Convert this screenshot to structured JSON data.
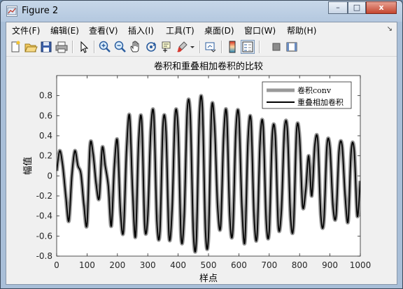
{
  "window": {
    "title": "Figure 2",
    "controls": {
      "minimize": "–",
      "maximize": "□",
      "close": "x"
    }
  },
  "menu": [
    "文件(F)",
    "编辑(E)",
    "查看(V)",
    "插入(I)",
    "工具(T)",
    "桌面(D)",
    "窗口(W)",
    "帮助(H)"
  ],
  "menu_overflow": "↘",
  "toolbar": [
    "new-figure-icon",
    "open-file-icon",
    "save-icon",
    "print-icon",
    "edit-plot-arrow-icon",
    "zoom-in-icon",
    "zoom-out-icon",
    "pan-hand-icon",
    "rotate-3d-icon",
    "data-cursor-icon",
    "brush-icon",
    "dropdown-arrow-icon",
    "link-plot-icon",
    "colorbar-icon",
    "legend-icon",
    "hide-plot-tools-icon",
    "show-plot-tools-icon"
  ],
  "colors": {
    "conv": "#999999",
    "overlap": "#000000",
    "axes_bg": "#ffffff"
  },
  "chart_data": {
    "type": "line",
    "title": "卷积和重叠相加卷积的比较",
    "xlabel": "样点",
    "ylabel": "幅值",
    "xlim": [
      0,
      1000
    ],
    "ylim": [
      -0.8,
      1.0
    ],
    "xticks": [
      0,
      100,
      200,
      300,
      400,
      500,
      600,
      700,
      800,
      900,
      1000
    ],
    "yticks": [
      -0.8,
      -0.6,
      -0.4,
      -0.2,
      0,
      0.2,
      0.4,
      0.6,
      0.8
    ],
    "ytick_labels": [
      "-0.8",
      "-0.6",
      "-0.4",
      "-0.2",
      "0",
      "0.2",
      "0.4",
      "0.6",
      "0.8"
    ],
    "grid": false,
    "legend_position": "top-right",
    "series": [
      {
        "name": "卷积conv",
        "color": "#999999",
        "style": "thick"
      },
      {
        "name": "重叠相加卷积",
        "color": "#000000",
        "style": "thin"
      }
    ],
    "x": [
      0,
      10,
      20,
      30,
      40,
      50,
      60,
      70,
      80,
      90,
      100,
      110,
      120,
      130,
      140,
      150,
      160,
      170,
      180,
      190,
      200,
      210,
      220,
      230,
      240,
      250,
      260,
      270,
      280,
      290,
      300,
      310,
      320,
      330,
      340,
      350,
      360,
      370,
      380,
      390,
      400,
      410,
      420,
      430,
      440,
      450,
      460,
      470,
      480,
      490,
      500,
      510,
      520,
      530,
      540,
      550,
      560,
      570,
      580,
      590,
      600,
      610,
      620,
      630,
      640,
      650,
      660,
      670,
      680,
      690,
      700,
      710,
      720,
      730,
      740,
      750,
      760,
      770,
      780,
      790,
      800,
      810,
      820,
      830,
      840,
      850,
      860,
      870,
      880,
      890,
      900,
      910,
      920,
      930,
      940,
      950,
      960,
      970,
      980,
      990,
      1000
    ],
    "y": [
      0.05,
      0.25,
      0.1,
      -0.2,
      -0.45,
      0.0,
      0.25,
      0.1,
      0.02,
      -0.3,
      -0.48,
      0.3,
      0.22,
      -0.08,
      -0.22,
      0.28,
      0.1,
      -0.1,
      -0.5,
      0.1,
      0.35,
      -0.35,
      -0.55,
      0.25,
      0.6,
      -0.15,
      -0.6,
      0.35,
      0.55,
      -0.5,
      -0.4,
      0.45,
      0.6,
      -0.45,
      -0.55,
      0.5,
      0.45,
      -0.6,
      -0.35,
      0.6,
      0.45,
      -0.62,
      -0.4,
      0.65,
      0.6,
      -0.55,
      -0.65,
      0.6,
      0.68,
      -0.55,
      -0.6,
      0.65,
      0.5,
      -0.3,
      -0.5,
      0.4,
      0.62,
      -0.4,
      -0.55,
      0.45,
      0.6,
      -0.3,
      -0.65,
      0.35,
      0.55,
      -0.4,
      -0.6,
      0.35,
      0.5,
      -0.45,
      -0.55,
      0.4,
      0.4,
      -0.5,
      -0.35,
      0.45,
      0.45,
      -0.4,
      -0.5,
      0.45,
      0.38,
      -0.3,
      -0.15,
      0.2,
      -0.2,
      0.3,
      0.35,
      -0.4,
      -0.45,
      0.3,
      0.28,
      -0.3,
      -0.4,
      0.25,
      0.3,
      -0.2,
      -0.45,
      0.25,
      0.25,
      -0.4,
      -0.05
    ]
  }
}
